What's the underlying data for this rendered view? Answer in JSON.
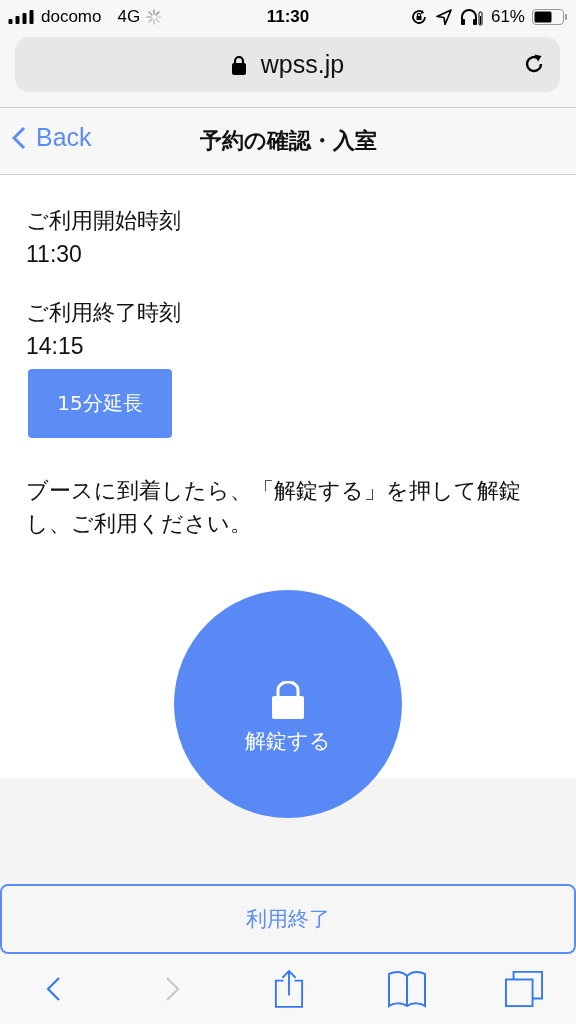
{
  "status_bar": {
    "carrier": "docomo",
    "network": "4G",
    "time": "11:30",
    "battery": "61%"
  },
  "address_bar": {
    "url": "wpss.jp"
  },
  "nav_bar": {
    "back": "Back",
    "title": "予約の確認・入室"
  },
  "fields": [
    {
      "label": "ご利用開始時刻",
      "value": "11:30"
    },
    {
      "label": "ご利用終了時刻",
      "value": "14:15"
    }
  ],
  "extend_button": "15分延長",
  "instruction": "ブースに到着したら、「解錠する」を押して解錠し、ご利用ください。",
  "unlock_button": "解錠する",
  "end_button": "利用終了",
  "toolbar": [
    {
      "kind": "back",
      "disabled": false
    },
    {
      "kind": "forward",
      "disabled": true
    },
    {
      "kind": "share",
      "disabled": false
    },
    {
      "kind": "bookmarks",
      "disabled": false
    },
    {
      "kind": "tabs",
      "disabled": false
    }
  ]
}
